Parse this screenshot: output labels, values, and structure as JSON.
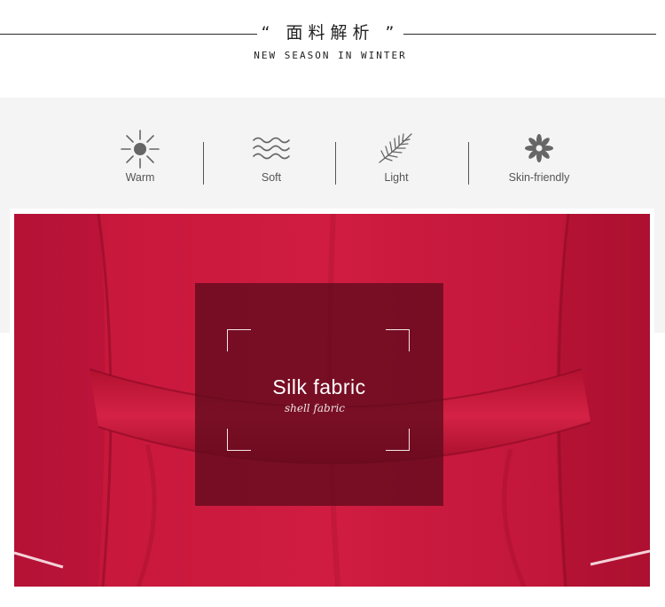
{
  "header": {
    "title_cn": "“ 面料解析 ”",
    "subtitle_en": "NEW SEASON IN WINTER"
  },
  "features": [
    {
      "label": "Warm",
      "icon": "sun-icon"
    },
    {
      "label": "Soft",
      "icon": "waves-icon"
    },
    {
      "label": "Light",
      "icon": "feather-icon"
    },
    {
      "label": "Skin-friendly",
      "icon": "flower-icon"
    }
  ],
  "fabric_card": {
    "title": "Silk fabric",
    "subtitle": "shell fabric"
  },
  "colors": {
    "fabric": "#c5173a",
    "card_overlay": "#5f0a1c",
    "band": "#f4f4f4",
    "text": "#555555"
  }
}
